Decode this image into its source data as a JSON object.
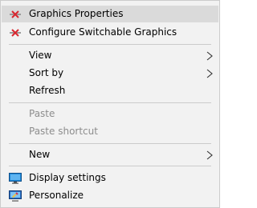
{
  "menu": {
    "items": [
      {
        "label": "Graphics Properties",
        "icon": "intel-graphics-icon"
      },
      {
        "label": "Configure Switchable Graphics",
        "icon": "intel-graphics-icon"
      },
      {
        "label": "View",
        "submenu": true
      },
      {
        "label": "Sort by",
        "submenu": true
      },
      {
        "label": "Refresh"
      },
      {
        "label": "Paste",
        "disabled": true
      },
      {
        "label": "Paste shortcut",
        "disabled": true
      },
      {
        "label": "New",
        "submenu": true
      },
      {
        "label": "Display settings",
        "icon": "display-settings-icon"
      },
      {
        "label": "Personalize",
        "icon": "personalize-icon"
      }
    ]
  },
  "colors": {
    "menu_bg": "#f2f2f2",
    "hover_bg": "#dadada",
    "disabled_text": "#8d8d8d",
    "separator": "#cbcbcb",
    "intel_icon_red": "#d9262e",
    "display_icon_blue": "#1e88d8"
  }
}
